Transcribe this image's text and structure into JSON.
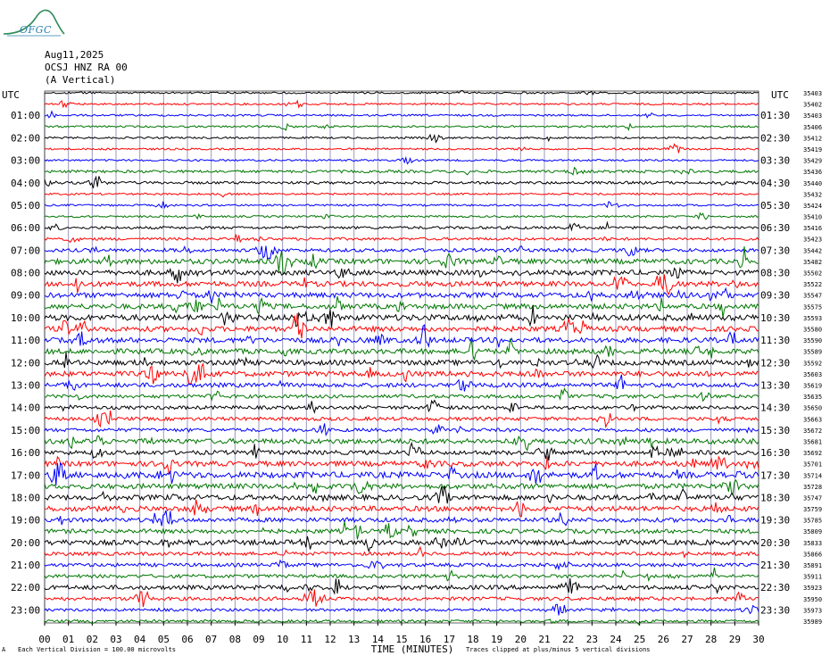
{
  "header": {
    "logo_text": "OFGC",
    "date": "Aug11,2025",
    "station": "OCSJ HNZ RA 00",
    "component": "(A Vertical)"
  },
  "footer": {
    "scale_note": "Each Vertical Division = 100.00 microvolts",
    "clip_note": "Traces clipped at plus/minus 5 vertical divisions",
    "corner_mark": "A"
  },
  "colors": {
    "line1": "#000000",
    "line2": "#ff0000",
    "line3": "#0000ff",
    "line4": "#007700",
    "grid": "#9999bb"
  },
  "chart_data": {
    "type": "line",
    "description_source": "helicorder",
    "xlabel": "TIME (MINUTES)",
    "x_ticks": [
      "00",
      "01",
      "02",
      "03",
      "04",
      "05",
      "06",
      "07",
      "08",
      "09",
      "10",
      "11",
      "12",
      "13",
      "14",
      "15",
      "16",
      "17",
      "18",
      "19",
      "20",
      "21",
      "22",
      "23",
      "24",
      "25",
      "26",
      "27",
      "28",
      "29",
      "30"
    ],
    "xlim": [
      0,
      30
    ],
    "left_axis_label": "UTC",
    "right_axis_label": "UTC",
    "left_labels": [
      "01:00",
      "02:00",
      "03:00",
      "04:00",
      "05:00",
      "06:00",
      "07:00",
      "08:00",
      "09:00",
      "10:00",
      "11:00",
      "12:00",
      "13:00",
      "14:00",
      "15:00",
      "16:00",
      "17:00",
      "18:00",
      "19:00",
      "20:00",
      "21:00",
      "22:00",
      "23:00"
    ],
    "right_labels": [
      "01:30",
      "02:30",
      "03:30",
      "04:30",
      "05:30",
      "06:30",
      "07:30",
      "08:30",
      "09:30",
      "10:30",
      "11:30",
      "12:30",
      "13:30",
      "14:30",
      "15:30",
      "16:30",
      "17:30",
      "18:30",
      "19:30",
      "20:30",
      "21:30",
      "22:30",
      "23:30"
    ],
    "counts": [
      "35403",
      "35402",
      "35403",
      "35406",
      "35412",
      "35419",
      "35429",
      "35436",
      "35440",
      "35432",
      "35424",
      "35410",
      "35416",
      "35423",
      "35442",
      "35482",
      "35502",
      "35522",
      "35547",
      "35575",
      "35593",
      "35580",
      "35590",
      "35589",
      "35592",
      "35603",
      "35619",
      "35635",
      "35650",
      "35663",
      "35672",
      "35681",
      "35692",
      "35701",
      "35714",
      "35728",
      "35747",
      "35759",
      "35785",
      "35809",
      "35833",
      "35866",
      "35891",
      "35911",
      "35923",
      "35950",
      "35973",
      "35989"
    ],
    "trace_colors": [
      "#000000",
      "#ff0000",
      "#0000ff",
      "#007700"
    ],
    "trace_count": 48,
    "trace_activity": [
      1,
      1,
      1,
      1,
      1,
      1,
      1,
      2,
      2,
      1,
      1,
      1,
      2,
      2,
      3,
      5,
      5,
      5,
      5,
      5,
      6,
      5,
      5,
      5,
      5,
      5,
      4,
      3,
      3,
      3,
      3,
      5,
      4,
      5,
      6,
      5,
      5,
      5,
      4,
      4,
      5,
      3,
      3,
      3,
      4,
      3,
      2,
      2
    ]
  }
}
